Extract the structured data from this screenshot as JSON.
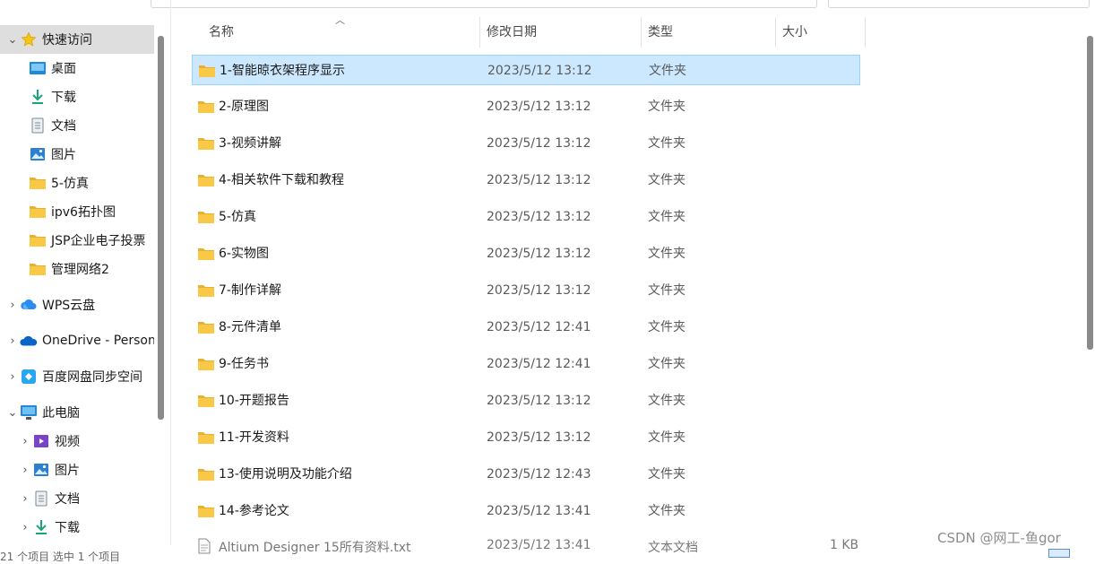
{
  "nav": {
    "items": [
      {
        "label": "快速访问",
        "icon": "star-icon",
        "expand": "⌄",
        "pinned": false
      },
      {
        "label": "桌面",
        "icon": "desktop-icon",
        "expand": "",
        "pinned": true
      },
      {
        "label": "下载",
        "icon": "download-icon",
        "expand": "",
        "pinned": true
      },
      {
        "label": "文档",
        "icon": "document-icon",
        "expand": "",
        "pinned": true
      },
      {
        "label": "图片",
        "icon": "pictures-icon",
        "expand": "",
        "pinned": true
      },
      {
        "label": "5-仿真",
        "icon": "folder-icon",
        "expand": "",
        "pinned": false
      },
      {
        "label": "ipv6拓扑图",
        "icon": "folder-icon",
        "expand": "",
        "pinned": false
      },
      {
        "label": "JSP企业电子投票",
        "icon": "folder-icon",
        "expand": "",
        "pinned": false
      },
      {
        "label": "管理网络2",
        "icon": "folder-icon",
        "expand": "",
        "pinned": false
      },
      {
        "label": "WPS云盘",
        "icon": "wps-cloud-icon",
        "expand": "›",
        "pinned": false
      },
      {
        "label": "OneDrive - Personal",
        "icon": "onedrive-icon",
        "expand": "›",
        "pinned": false
      },
      {
        "label": "百度网盘同步空间",
        "icon": "baidu-netdisk-icon",
        "expand": "›",
        "pinned": false
      },
      {
        "label": "此电脑",
        "icon": "computer-icon",
        "expand": "⌄",
        "pinned": false
      },
      {
        "label": "视频",
        "icon": "video-icon",
        "expand": "›",
        "pinned": false
      },
      {
        "label": "图片",
        "icon": "pictures-icon",
        "expand": "›",
        "pinned": false
      },
      {
        "label": "文档",
        "icon": "document-icon",
        "expand": "›",
        "pinned": false
      },
      {
        "label": "下载",
        "icon": "download-icon",
        "expand": "›",
        "pinned": false
      }
    ]
  },
  "columns": {
    "name": "名称",
    "date": "修改日期",
    "type": "类型",
    "size": "大小"
  },
  "files": [
    {
      "name": "1-智能晾衣架程序显示",
      "date": "2023/5/12 13:12",
      "type": "文件夹"
    },
    {
      "name": "2-原理图",
      "date": "2023/5/12 13:12",
      "type": "文件夹"
    },
    {
      "name": "3-视频讲解",
      "date": "2023/5/12 13:12",
      "type": "文件夹"
    },
    {
      "name": "4-相关软件下载和教程",
      "date": "2023/5/12 13:12",
      "type": "文件夹"
    },
    {
      "name": "5-仿真",
      "date": "2023/5/12 13:12",
      "type": "文件夹"
    },
    {
      "name": "6-实物图",
      "date": "2023/5/12 13:12",
      "type": "文件夹"
    },
    {
      "name": "7-制作详解",
      "date": "2023/5/12 13:12",
      "type": "文件夹"
    },
    {
      "name": "8-元件清单",
      "date": "2023/5/12 12:41",
      "type": "文件夹"
    },
    {
      "name": "9-任务书",
      "date": "2023/5/12 12:41",
      "type": "文件夹"
    },
    {
      "name": "10-开题报告",
      "date": "2023/5/12 13:12",
      "type": "文件夹"
    },
    {
      "name": "11-开发资料",
      "date": "2023/5/12 13:12",
      "type": "文件夹"
    },
    {
      "name": "13-使用说明及功能介绍",
      "date": "2023/5/12 12:43",
      "type": "文件夹"
    },
    {
      "name": "14-参考论文",
      "date": "2023/5/12 13:41",
      "type": "文件夹"
    }
  ],
  "partial_row": {
    "name": "Altium Designer 15所有资料.txt",
    "date": "2023/5/12 13:41",
    "type": "文本文档",
    "size": "1 KB"
  },
  "status": "21 个项目    选中 1 个项目",
  "watermark": "CSDN @网工-鱼gor",
  "colors": {
    "selection": "#cce8ff",
    "selection_border": "#99d1ff",
    "folder": "#f8c846",
    "nav_selected": "#dedede"
  }
}
